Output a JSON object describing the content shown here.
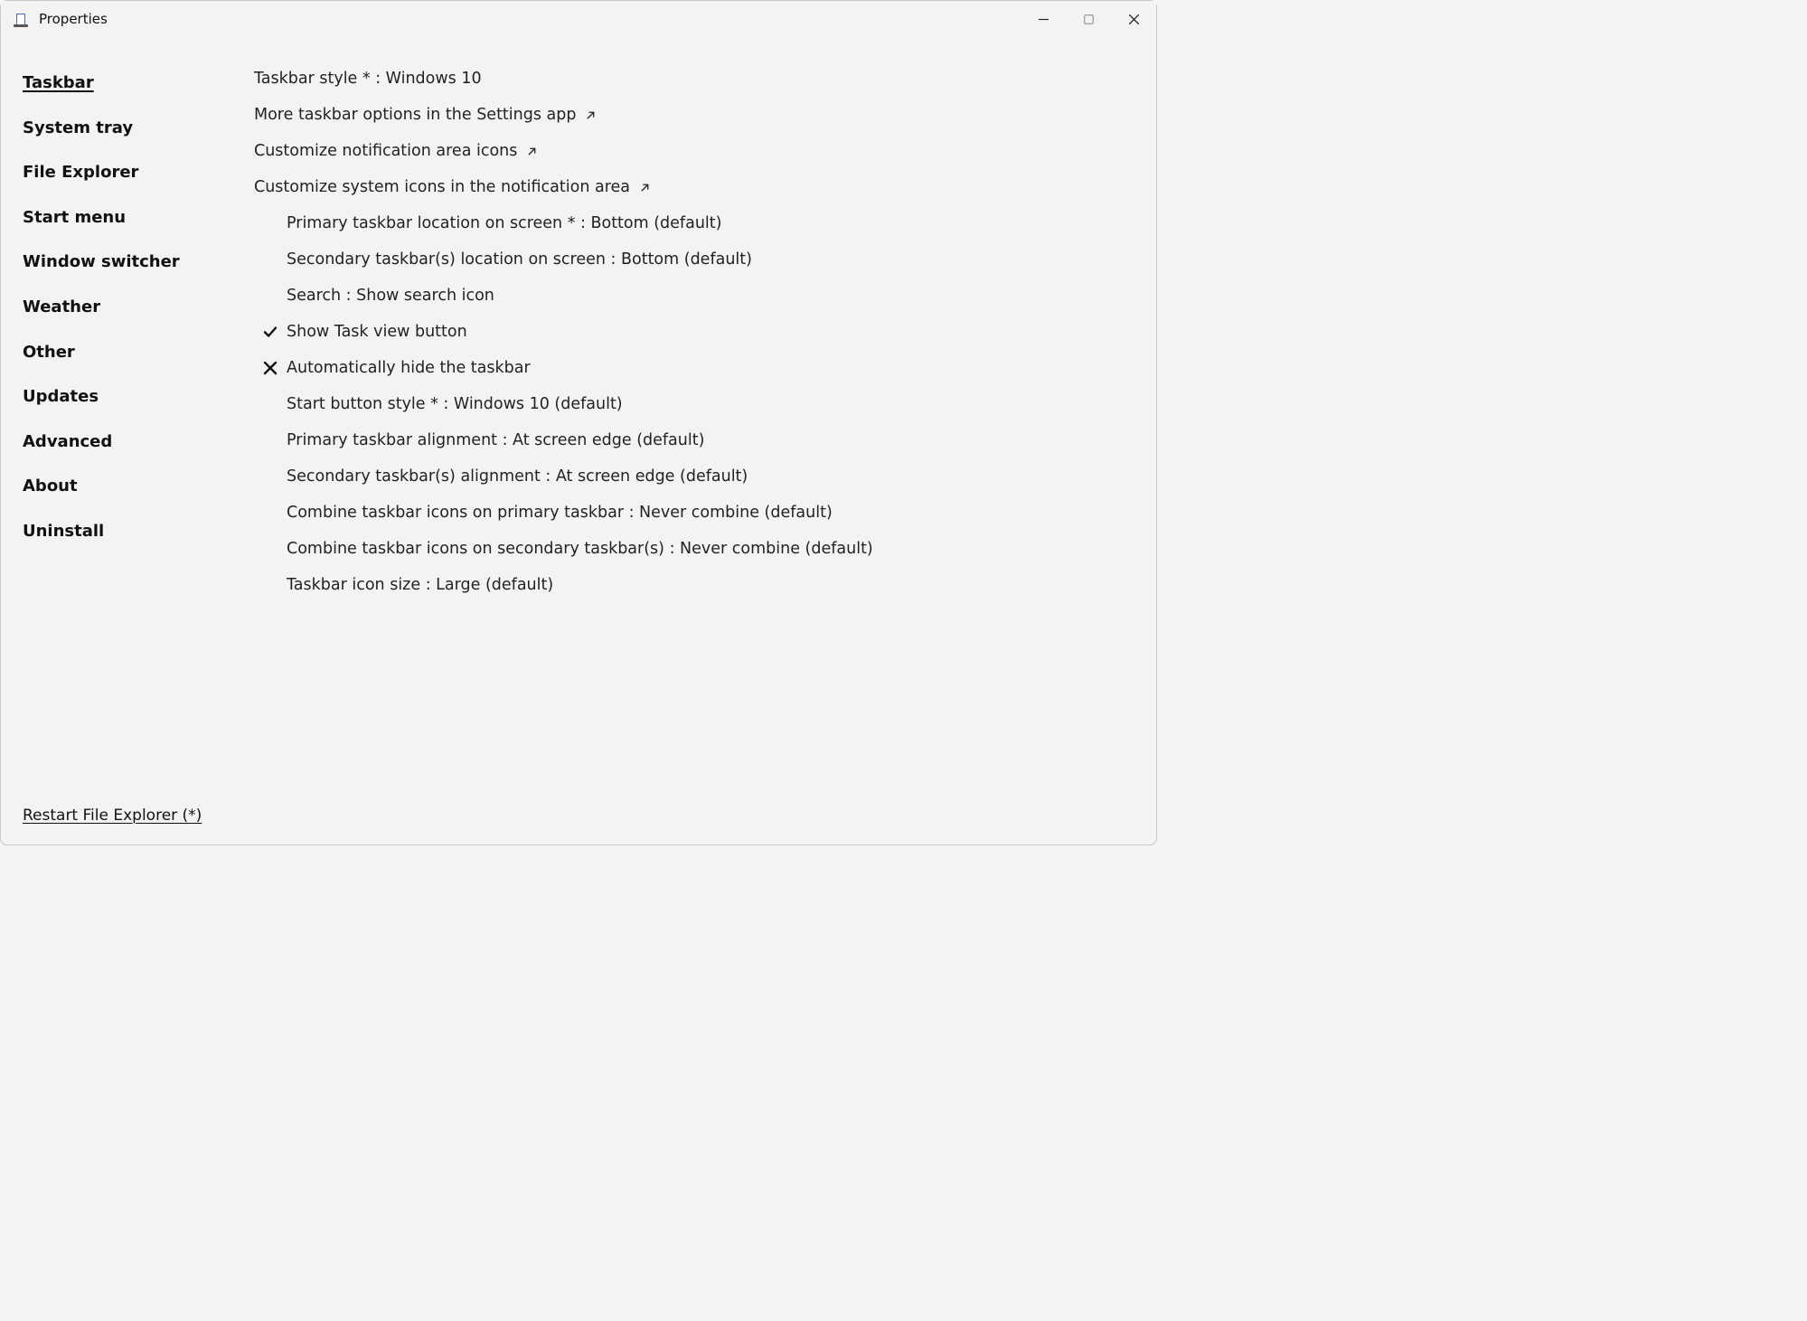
{
  "window": {
    "title": "Properties"
  },
  "sidebar": {
    "items": [
      {
        "label": "Taskbar",
        "active": true
      },
      {
        "label": "System tray",
        "active": false
      },
      {
        "label": "File Explorer",
        "active": false
      },
      {
        "label": "Start menu",
        "active": false
      },
      {
        "label": "Window switcher",
        "active": false
      },
      {
        "label": "Weather",
        "active": false
      },
      {
        "label": "Other",
        "active": false
      },
      {
        "label": "Updates",
        "active": false
      },
      {
        "label": "Advanced",
        "active": false
      },
      {
        "label": "About",
        "active": false
      },
      {
        "label": "Uninstall",
        "active": false
      }
    ],
    "footer_link": "Restart File Explorer (*)"
  },
  "settings": [
    {
      "type": "top",
      "text": "Taskbar style * : Windows 10"
    },
    {
      "type": "top-link",
      "text": "More taskbar options in the Settings app"
    },
    {
      "type": "top-link",
      "text": "Customize notification area icons"
    },
    {
      "type": "top-link",
      "text": "Customize system icons in the notification area"
    },
    {
      "type": "indent",
      "text": "Primary taskbar location on screen * : Bottom (default)"
    },
    {
      "type": "indent",
      "text": "Secondary taskbar(s) location on screen : Bottom (default)"
    },
    {
      "type": "indent",
      "text": "Search : Show search icon"
    },
    {
      "type": "indent-check",
      "checked": true,
      "text": "Show Task view button"
    },
    {
      "type": "indent-check",
      "checked": false,
      "text": "Automatically hide the taskbar"
    },
    {
      "type": "indent",
      "text": "Start button style * : Windows 10 (default)"
    },
    {
      "type": "indent",
      "text": "Primary taskbar alignment : At screen edge (default)"
    },
    {
      "type": "indent",
      "text": "Secondary taskbar(s) alignment : At screen edge (default)"
    },
    {
      "type": "indent",
      "text": "Combine taskbar icons on primary taskbar : Never combine (default)"
    },
    {
      "type": "indent",
      "text": "Combine taskbar icons on secondary taskbar(s) : Never combine (default)"
    },
    {
      "type": "indent",
      "text": "Taskbar icon size : Large (default)"
    }
  ]
}
